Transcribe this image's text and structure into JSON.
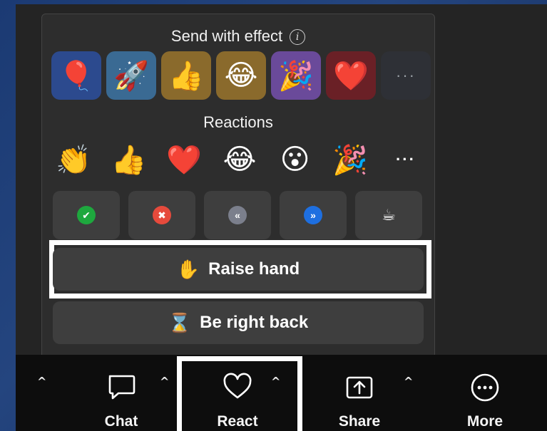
{
  "popup": {
    "effects_title": "Send with effect",
    "effects": [
      {
        "name": "balloon-effect",
        "glyph": "🎈"
      },
      {
        "name": "rocket-effect",
        "glyph": "🚀"
      },
      {
        "name": "thumbs-up-effect",
        "glyph": "👍"
      },
      {
        "name": "laughing-effect",
        "glyph": "😂"
      },
      {
        "name": "party-popper-effect",
        "glyph": "🎉"
      },
      {
        "name": "heart-effect",
        "glyph": "❤️"
      },
      {
        "name": "more-effects",
        "glyph": "···"
      }
    ],
    "reactions_title": "Reactions",
    "reactions": [
      {
        "name": "clap-reaction",
        "glyph": "👏"
      },
      {
        "name": "thumbs-up-reaction",
        "glyph": "👍"
      },
      {
        "name": "heart-reaction",
        "glyph": "❤️"
      },
      {
        "name": "joy-reaction",
        "glyph": "😂"
      },
      {
        "name": "surprised-reaction",
        "glyph": "😮"
      },
      {
        "name": "tada-reaction",
        "glyph": "🎉"
      },
      {
        "name": "more-reactions",
        "glyph": "···"
      }
    ],
    "statuses": {
      "yes": "✔",
      "no": "✖",
      "slower": "«",
      "faster": "»",
      "coffee": "☕"
    },
    "raise_hand": {
      "emoji": "✋",
      "label": "Raise hand"
    },
    "be_right_back": {
      "emoji": "⌛",
      "label": "Be right back"
    }
  },
  "toolbar": {
    "caret": "^",
    "chat_label": "Chat",
    "react_label": "React",
    "share_label": "Share",
    "more_label": "More"
  },
  "colors": {
    "popup_bg": "#2d2d2d",
    "button_bg": "#3e3e3e",
    "toolbar_bg": "#0d0d0d",
    "green": "#1ea83e",
    "red": "#e64a3c",
    "blue": "#1e6fe0"
  }
}
